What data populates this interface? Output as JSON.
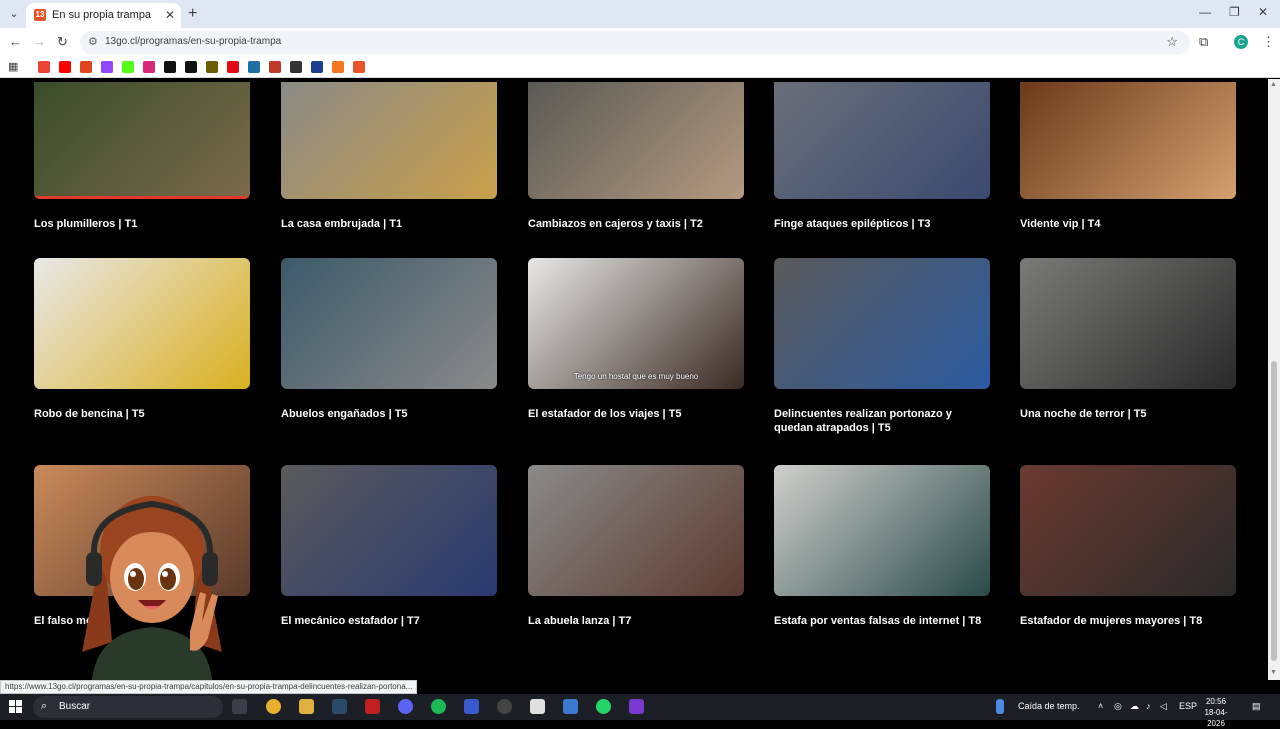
{
  "browser": {
    "tab_title": "En su propia trampa",
    "url": "13go.cl/programas/en-su-propia-trampa",
    "status_url": "https://www.13go.cl/programas/en-su-propia-trampa/capitulos/en-su-propia-trampa-delincuentes-realizan-portona..."
  },
  "bookmarks": [
    {
      "icon": "gmail-icon",
      "color": "#ea4335"
    },
    {
      "icon": "youtube-icon",
      "color": "#ff0000"
    },
    {
      "icon": "fire-icon",
      "color": "#e0451f"
    },
    {
      "icon": "twitch-icon",
      "color": "#9146ff"
    },
    {
      "icon": "kick-icon",
      "color": "#53fc18"
    },
    {
      "icon": "instagram-icon",
      "color": "#d62976"
    },
    {
      "icon": "tiktok-icon",
      "color": "#111111"
    },
    {
      "icon": "x-icon",
      "color": "#111111"
    },
    {
      "icon": "bookmark-icon",
      "color": "#6b5b00"
    },
    {
      "icon": "netflix-icon",
      "color": "#e50914"
    },
    {
      "icon": "bookmark-icon",
      "color": "#1d6fa5"
    },
    {
      "icon": "record-icon",
      "color": "#c0392b"
    },
    {
      "icon": "bookmark-icon",
      "color": "#333333"
    },
    {
      "icon": "bookmark-icon",
      "color": "#1a3d8f"
    },
    {
      "icon": "crunchyroll-icon",
      "color": "#f47521"
    },
    {
      "icon": "bookmark-icon",
      "color": "#e8542a"
    }
  ],
  "episodes": [
    {
      "title": "Los plumilleros | T1",
      "c1": "#3a4d2a",
      "c2": "#7a6a4a",
      "progress": 1.0
    },
    {
      "title": "La casa embrujada | T1",
      "c1": "#8a8a86",
      "c2": "#c9a04a"
    },
    {
      "title": "Cambiazos en cajeros y taxis | T2",
      "c1": "#5a5a55",
      "c2": "#b39a80"
    },
    {
      "title": "Finge ataques epilépticos | T3",
      "c1": "#6a6f78",
      "c2": "#3a4a70"
    },
    {
      "title": "Vidente vip | T4",
      "c1": "#6a3a1a",
      "c2": "#d4a070"
    },
    {
      "title": "Robo de bencina | T5",
      "c1": "#e8e8e8",
      "c2": "#d9b020"
    },
    {
      "title": "Abuelos engañados | T5",
      "c1": "#3d5a6a",
      "c2": "#8a8a8a"
    },
    {
      "title": "El estafador de los viajes | T5",
      "c1": "#e8e8e6",
      "c2": "#3a2a22",
      "subtitle": "Tengo un hostal que es muy bueno"
    },
    {
      "title": "Delincuentes realizan portonazo y quedan atrapados | T5",
      "c1": "#5a5a5a",
      "c2": "#2a5aa0"
    },
    {
      "title": "Una noche de terror | T5",
      "c1": "#7a7a78",
      "c2": "#2a2a2a"
    },
    {
      "title": "El falso mé",
      "c1": "#c98a5a",
      "c2": "#5a3a2a"
    },
    {
      "title": "El mecánico estafador | T7",
      "c1": "#5a5a5a",
      "c2": "#2a3a70"
    },
    {
      "title": "La abuela lanza | T7",
      "c1": "#8a8a88",
      "c2": "#5a3a30"
    },
    {
      "title": "Estafa por ventas falsas de internet | T8",
      "c1": "#d0d0cc",
      "c2": "#2a4a4a"
    },
    {
      "title": "Estafador de mujeres mayores | T8",
      "c1": "#6a3a30",
      "c2": "#2a2a2a"
    }
  ],
  "taskbar": {
    "search_label": "Buscar",
    "weather": "Caída de temp.",
    "lang": "ESP",
    "time": "20:56",
    "date": "18-04-2026"
  }
}
